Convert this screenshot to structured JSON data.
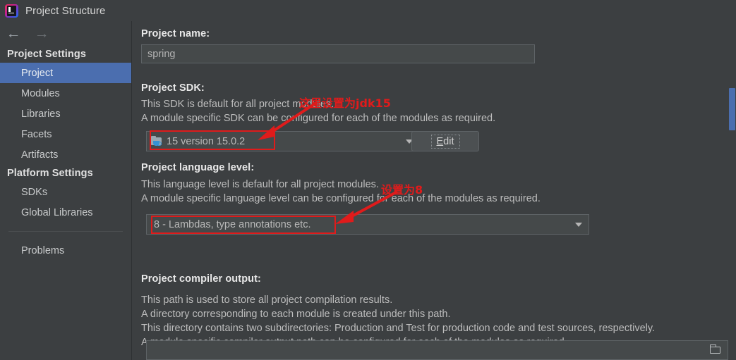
{
  "window": {
    "title": "Project Structure",
    "app_icon": "intellij-idea-logo"
  },
  "nav": {
    "back_icon": "arrow-left-icon",
    "forward_icon": "arrow-right-icon"
  },
  "sidebar": {
    "groups": [
      {
        "header": "Project Settings",
        "items": [
          {
            "label": "Project",
            "selected": true
          },
          {
            "label": "Modules",
            "selected": false
          },
          {
            "label": "Libraries",
            "selected": false
          },
          {
            "label": "Facets",
            "selected": false
          },
          {
            "label": "Artifacts",
            "selected": false
          }
        ]
      },
      {
        "header": "Platform Settings",
        "items": [
          {
            "label": "SDKs",
            "selected": false
          },
          {
            "label": "Global Libraries",
            "selected": false
          }
        ]
      }
    ],
    "extra_item": {
      "label": "Problems",
      "selected": false
    }
  },
  "main": {
    "project_name": {
      "label": "Project name:",
      "value": "spring"
    },
    "project_sdk": {
      "label": "Project SDK:",
      "desc_line1": "This SDK is default for all project modules.",
      "desc_line2": "A module specific SDK can be configured for each of the modules as required.",
      "selected": "15 version 15.0.2",
      "sdk_icon": "java-sdk-folder-icon",
      "edit_button": {
        "label": "Edit",
        "mnemonic": "E",
        "rest": "dit"
      }
    },
    "language_level": {
      "label": "Project language level:",
      "desc_line1": "This language level is default for all project modules.",
      "desc_line2": "A module specific language level can be configured for each of the modules as required.",
      "selected": "8 - Lambdas, type annotations etc."
    },
    "compiler_output": {
      "label": "Project compiler output:",
      "desc_line1": "This path is used to store all project compilation results.",
      "desc_line2": "A directory corresponding to each module is created under this path.",
      "desc_line3": "This directory contains two subdirectories: Production and Test for production code and test sources, respectively.",
      "desc_line4": "A module specific compiler output path can be configured for each of the modules as required.",
      "path_value": "",
      "browse_icon": "folder-browse-icon"
    }
  },
  "annotations": [
    {
      "text": "这里设置为jdk15"
    },
    {
      "text": "设置为8"
    }
  ],
  "colors": {
    "background": "#3c3f41",
    "selection_blue": "#4b6eaf",
    "annotation_red": "#e01b1b",
    "field_background": "#45494a",
    "text_primary": "#e0e0e0",
    "text_secondary": "#bdbdbd"
  },
  "scrollbar": {
    "thumb_color": "#4b6eaf"
  }
}
